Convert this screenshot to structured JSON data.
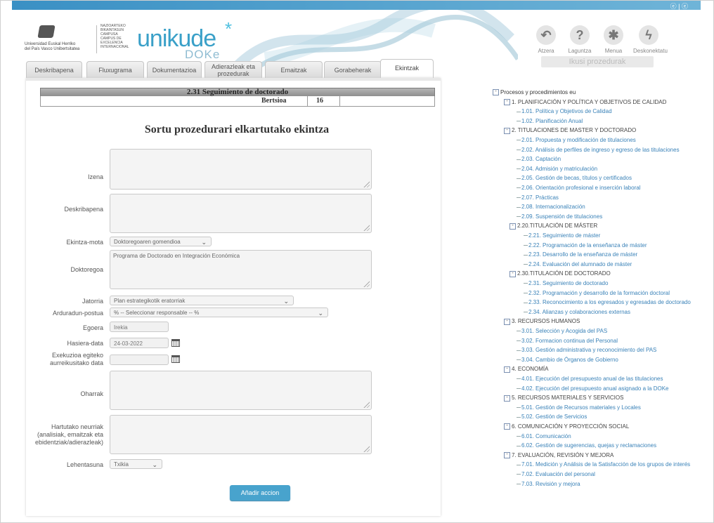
{
  "header": {
    "lang_links": "ⓔ | ⓔ",
    "university_lines": [
      "Universidad",
      "del País Vasco",
      "Euskal Herriko",
      "Unibertsitatea"
    ],
    "campus_lines": [
      "NAZIOARTEKO",
      "BIKAINTASUN",
      "CAMPUSA",
      "CAMPUS DE",
      "EXCELENCIA",
      "INTERNACIONAL"
    ],
    "brand": "unikude",
    "brand_sub": "DOKe",
    "tools": [
      {
        "icon": "back-arrow-icon",
        "glyph": "↶",
        "label": "Atzera"
      },
      {
        "icon": "help-icon",
        "glyph": "?",
        "label": "Laguntza"
      },
      {
        "icon": "menu-icon",
        "glyph": "✱",
        "label": "Menua"
      },
      {
        "icon": "disconnect-icon",
        "glyph": "ϟ",
        "label": "Deskonektatu"
      }
    ],
    "ikusi": "Ikusi prozedurak"
  },
  "tabs": [
    {
      "label": "Deskribapena"
    },
    {
      "label": "Fluxugrama"
    },
    {
      "label": "Dokumentazioa"
    },
    {
      "label": "Adierazleak eta prozedurak"
    },
    {
      "label": "Emaitzak"
    },
    {
      "label": "Gorabeherak"
    },
    {
      "label": "Ekintzak",
      "active": true
    }
  ],
  "procedure": {
    "title": "2.31 Seguimiento de doctorado",
    "version_label": "Bertsioa",
    "version": "16"
  },
  "form": {
    "title": "Sortu prozedurari elkartutako ekintza",
    "fields": {
      "izena": {
        "label": "Izena",
        "value": ""
      },
      "deskribapena": {
        "label": "Deskribapena",
        "value": ""
      },
      "ekintza_mota": {
        "label": "Ekintza-mota",
        "value": "Doktoregoaren gomendioa"
      },
      "doktoregoa": {
        "label": "Doktoregoa",
        "value": "Programa de Doctorado en Integración Económica"
      },
      "jatorria": {
        "label": "Jatorria",
        "value": "Plan estrategikotik eratorriak"
      },
      "arduradun": {
        "label": "Arduradun-postua",
        "value": "% -- Seleccionar responsable -- %"
      },
      "egoera": {
        "label": "Egoera",
        "value": "Irekia"
      },
      "hasiera": {
        "label": "Hasiera-data",
        "value": "24-03-2022"
      },
      "exekuzioa_label_1": "Exekuzioa egiteko",
      "exekuzioa_label_2": "aurreikusitako data",
      "exekuzioa_value": "",
      "oharrak": {
        "label": "Oharrak",
        "value": ""
      },
      "hartutako_1": "Hartutako neurriak",
      "hartutako_2": "(analisiak, emaitzak eta",
      "hartutako_3": "ebidentziak/adierazleak)",
      "hartutako_value": "",
      "lehentasuna": {
        "label": "Lehentasuna",
        "value": "Txikia"
      }
    },
    "submit": "Añadir accion"
  },
  "tree": {
    "root": "Procesos y procedimientos eu",
    "items": [
      {
        "level": 1,
        "text": "1. PLANIFICACIÓN Y POLÍTICA Y OBJETIVOS DE CALIDAD"
      },
      {
        "level": 2,
        "text": "1.01. Política y Objetivos de Calidad"
      },
      {
        "level": 2,
        "text": "1.02. Planificación Anual"
      },
      {
        "level": 1,
        "text": "2. TITULACIONES DE MASTER Y DOCTORADO"
      },
      {
        "level": 2,
        "text": "2.01. Propuesta y modificación de titulaciones"
      },
      {
        "level": 2,
        "text": "2.02. Análisis de perfiles de ingreso y egreso de las titulaciones"
      },
      {
        "level": 2,
        "text": "2.03. Captación"
      },
      {
        "level": 2,
        "text": "2.04. Admisión y matriculación"
      },
      {
        "level": 2,
        "text": "2.05. Gestión de becas, títulos y certificados"
      },
      {
        "level": 2,
        "text": "2.06. Orientación profesional e inserción laboral"
      },
      {
        "level": 2,
        "text": "2.07. Prácticas"
      },
      {
        "level": 2,
        "text": "2.08. Internacionalización"
      },
      {
        "level": 2,
        "text": "2.09. Suspensión de titulaciones"
      },
      {
        "level": 3,
        "text": "2.20.TITULACIÓN DE MÁSTER"
      },
      {
        "level": 4,
        "text": "2.21. Seguimiento de máster"
      },
      {
        "level": 4,
        "text": "2.22. Programación de la enseñanza de máster"
      },
      {
        "level": 4,
        "text": "2.23. Desarrollo de la enseñanza de máster"
      },
      {
        "level": 4,
        "text": "2.24. Evaluación del alumnado de máster"
      },
      {
        "level": 3,
        "text": "2.30.TITULACIÓN DE DOCTORADO"
      },
      {
        "level": 4,
        "text": "2.31. Seguimiento de doctorado"
      },
      {
        "level": 4,
        "text": "2.32. Programación y desarrollo de la formación doctoral"
      },
      {
        "level": 4,
        "text": "2.33. Reconocimiento a los egresados y egresadas de doctorado"
      },
      {
        "level": 4,
        "text": "2.34. Alianzas y colaboraciones externas"
      },
      {
        "level": 1,
        "text": "3. RECURSOS HUMANOS"
      },
      {
        "level": 2,
        "text": "3.01. Selección y Acogida del PAS"
      },
      {
        "level": 2,
        "text": "3.02. Formacion continua del Personal"
      },
      {
        "level": 2,
        "text": "3.03. Gestión administrativa y reconocimiento del PAS"
      },
      {
        "level": 2,
        "text": "3.04. Cambio de Órganos de Gobierno"
      },
      {
        "level": 1,
        "text": "4. ECONOMÍA"
      },
      {
        "level": 2,
        "text": "4.01. Ejecución del presupuesto anual de las titulaciones"
      },
      {
        "level": 2,
        "text": "4.02. Ejecución del presupuesto anual asignado a la DOKe"
      },
      {
        "level": 1,
        "text": "5. RECURSOS MATERIALES Y SERVICIOS"
      },
      {
        "level": 2,
        "text": "5.01. Gestión de Recursos materiales y Locales"
      },
      {
        "level": 2,
        "text": "5.02. Gestión de Servicios"
      },
      {
        "level": 1,
        "text": "6. COMUNICACIÓN Y PROYECCIÓN SOCIAL"
      },
      {
        "level": 2,
        "text": "6.01. Comunicación"
      },
      {
        "level": 2,
        "text": "6.02. Gestión de sugerencias, quejas y reclamaciones"
      },
      {
        "level": 1,
        "text": "7. EVALUACIÓN, REVISIÓN Y MEJORA"
      },
      {
        "level": 2,
        "text": "7.01. Medición y Análisis de la Satisfacción de los grupos de interés"
      },
      {
        "level": 2,
        "text": "7.02. Evaluación del personal"
      },
      {
        "level": 2,
        "text": "7.03. Revisión y mejora"
      }
    ]
  },
  "colors": {
    "accent": "#48a3cd",
    "tree_link": "#3a82b8",
    "brand": "#3aa0c8"
  }
}
